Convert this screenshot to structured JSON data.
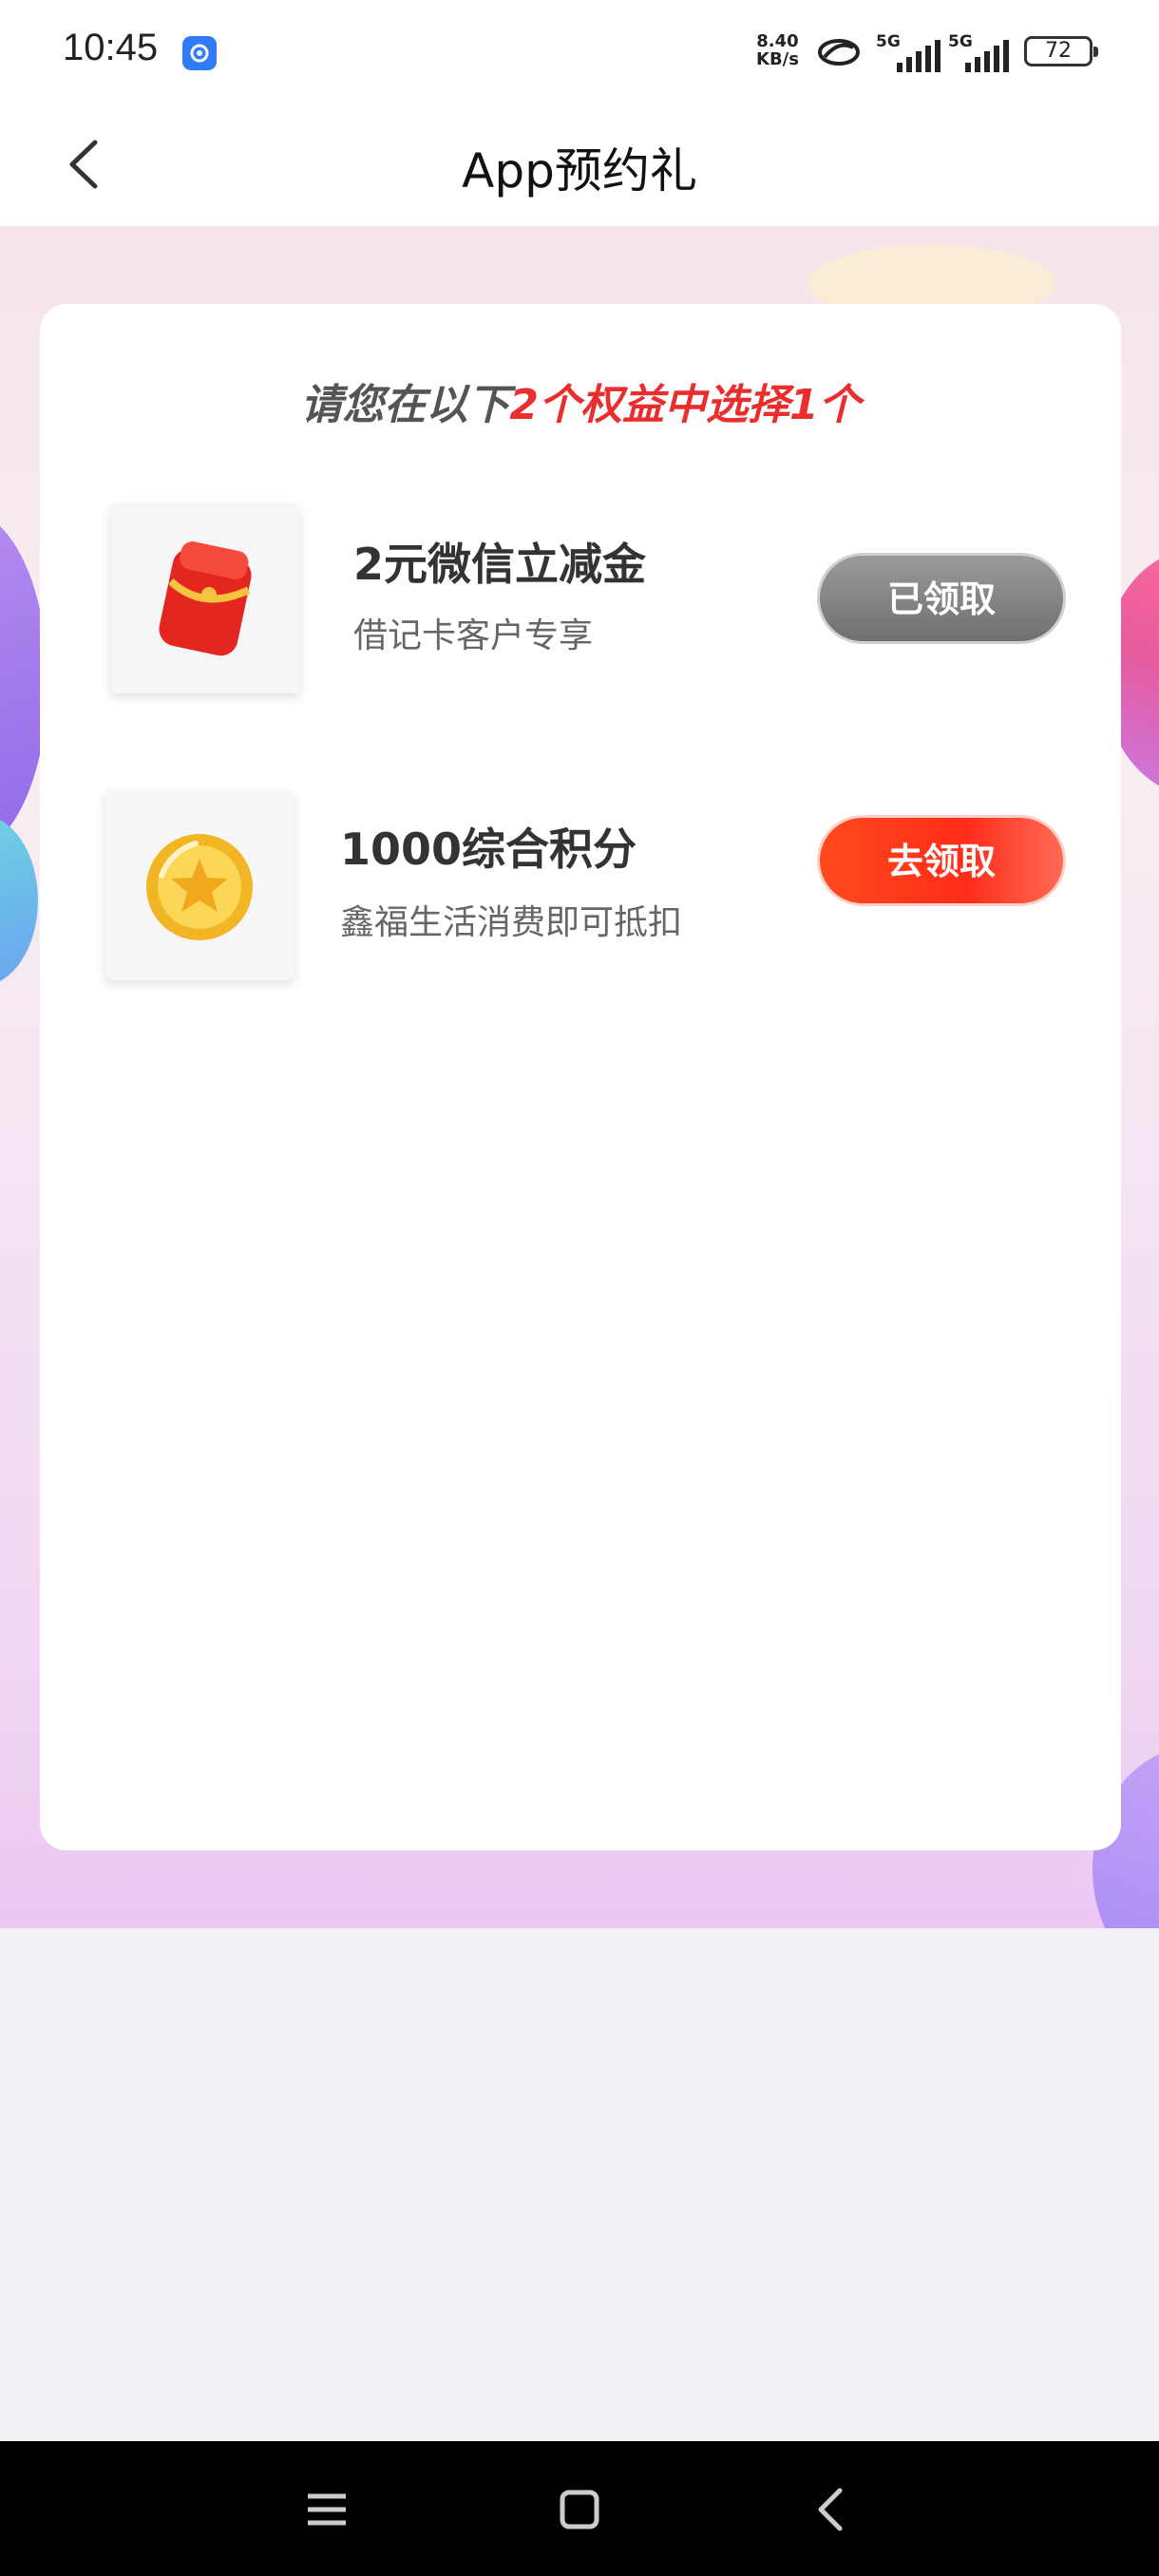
{
  "status_bar": {
    "time": "10:45",
    "net_speed_value": "8.40",
    "net_speed_unit": "KB/s",
    "signal1_label": "5G",
    "signal2_label": "5G",
    "battery": "72",
    "icons": [
      "app-notification-icon",
      "link-icon",
      "signal-icon",
      "battery-icon"
    ]
  },
  "header": {
    "title": "App预约礼"
  },
  "card": {
    "heading_prefix": "请您在以下",
    "heading_count": "2个权益中选择1个",
    "benefits": [
      {
        "name": "2元微信立减金",
        "desc": "借记卡客户专享",
        "button": "已领取",
        "icon": "red-envelope-icon",
        "state": "claimed"
      },
      {
        "name": "1000综合积分",
        "desc": "鑫福生活消费即可抵扣",
        "button": "去领取",
        "icon": "gold-coin-icon",
        "state": "available"
      }
    ]
  },
  "nav": {
    "icons": [
      "menu-icon",
      "home-icon",
      "back-icon"
    ]
  },
  "colors": {
    "accent_red": "#ea2e2e",
    "button_orange": "#ff3b1c",
    "button_gray": "#8a8a8a"
  }
}
